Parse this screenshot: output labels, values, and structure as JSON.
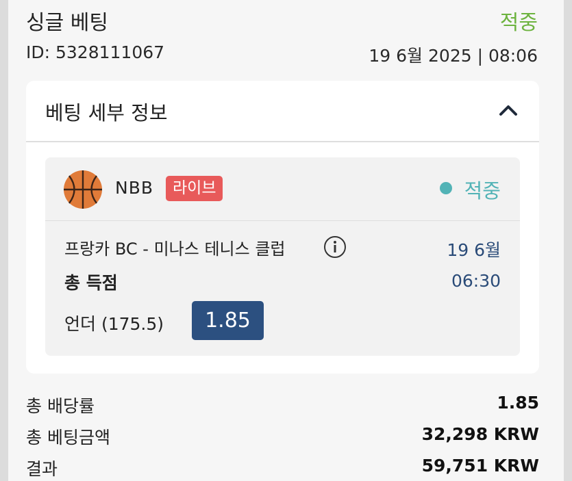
{
  "header": {
    "title": "싱글 베팅",
    "status": "적중",
    "bet_id": "ID: 5328111067",
    "datetime": "19 6월 2025 | 08:06"
  },
  "details": {
    "title": "베팅 세부 정보",
    "toggle_icon": "chevron-up-icon"
  },
  "selection": {
    "sport_icon": "basketball-icon",
    "league": "NBB",
    "live_badge": "라이브",
    "status": "적중",
    "match": "프랑카 BC - 미나스 테니스 클럽",
    "match_info_icon": "info-icon",
    "date": "19 6월",
    "time": "06:30",
    "market": "총 득점",
    "pick": "언더 (175.5)",
    "odds": "1.85"
  },
  "summary": [
    {
      "label": "총 배당률",
      "value": "1.85"
    },
    {
      "label": "총 베팅금액",
      "value": "32,298 KRW"
    },
    {
      "label": "결과",
      "value": "59,751 KRW"
    }
  ],
  "colors": {
    "won_green": "#6db33f",
    "won_teal": "#52b3b6",
    "live_red": "#e85a5a",
    "odds_blue": "#2c5080",
    "date_blue": "#2a4b78"
  }
}
